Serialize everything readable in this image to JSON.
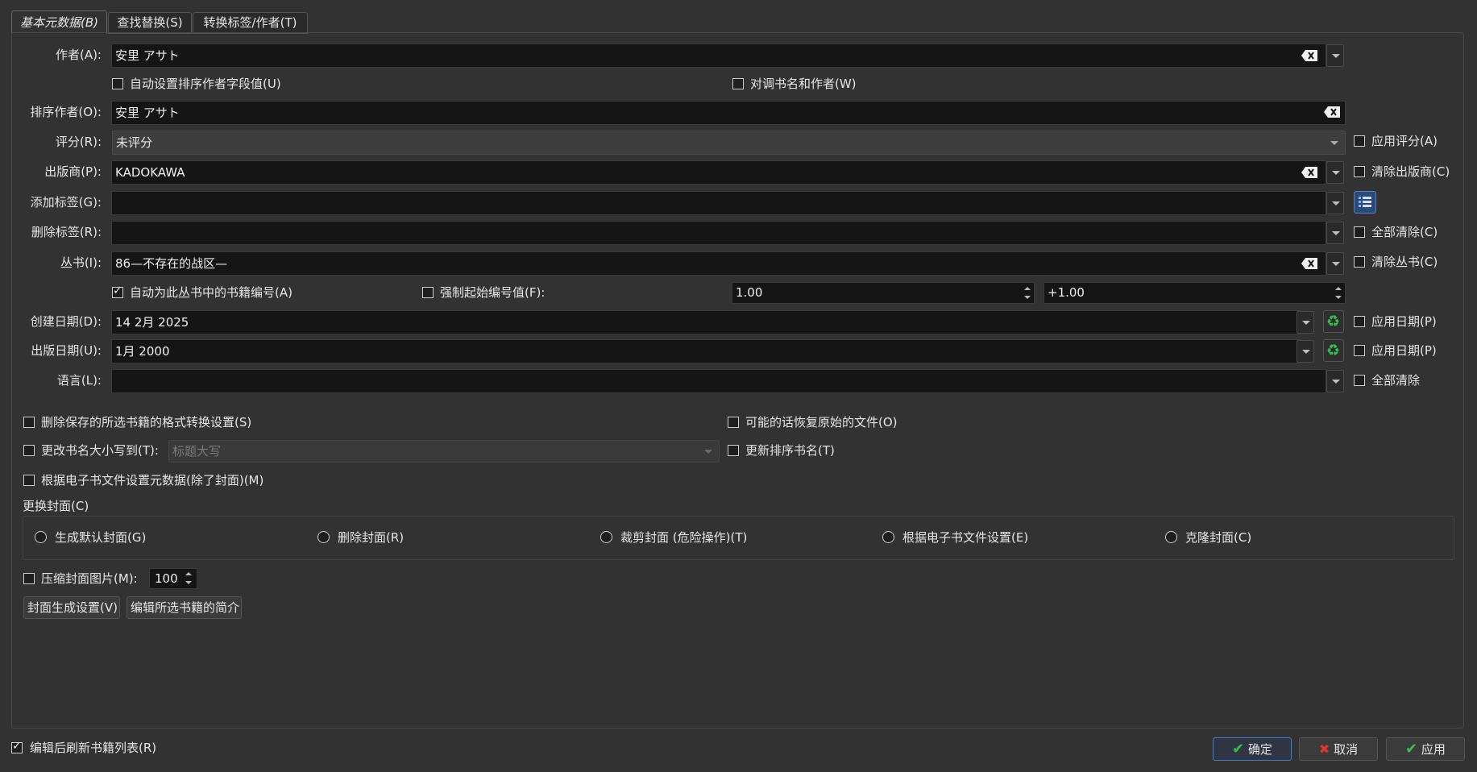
{
  "tabs": [
    {
      "label": "基本元数据(B)"
    },
    {
      "label": "查找替换(S)"
    },
    {
      "label": "转换标签/作者(T)"
    }
  ],
  "form": {
    "authors": {
      "label": "作者(A):",
      "value": "安里 アサト"
    },
    "auto_sort_label": "自动设置排序作者字段值(U)",
    "swap_label": "对调书名和作者(W)",
    "author_sort": {
      "label": "排序作者(O):",
      "value": "安里 アサト"
    },
    "rating": {
      "label": "评分(R):",
      "value": "未评分",
      "apply_label": "应用评分(A)"
    },
    "publisher": {
      "label": "出版商(P):",
      "value": "KADOKAWA",
      "clear_label": "清除出版商(C)"
    },
    "add_tags": {
      "label": "添加标签(G):",
      "value": ""
    },
    "remove_tags": {
      "label": "删除标签(R):",
      "value": "",
      "clear_label": "全部清除(C)"
    },
    "series": {
      "label": "丛书(I):",
      "value": "86—不存在的战区—",
      "clear_label": "清除丛书(C)"
    },
    "auto_number_label": "自动为此丛书中的书籍编号(A)",
    "force_start_label": "强制起始编号值(F):",
    "start_value": "1.00",
    "increment_value": "+1.00",
    "created": {
      "label": "创建日期(D):",
      "value": "14 2月 2025",
      "apply_label": "应用日期(P)"
    },
    "published": {
      "label": "出版日期(U):",
      "value": "1月 2000",
      "apply_label": "应用日期(P)"
    },
    "language": {
      "label": "语言(L):",
      "value": "",
      "clear_label": "全部清除"
    }
  },
  "options": {
    "remove_conversion": "删除保存的所选书籍的格式转换设置(S)",
    "restore_original": "可能的话恢复原始的文件(O)",
    "change_case": "更改书名大小写到(T):",
    "case_placeholder": "标题大写",
    "update_sort_title": "更新排序书名(T)",
    "set_from_file": "根据电子书文件设置元数据(除了封面)(M)"
  },
  "cover": {
    "group_label": "更换封面(C)",
    "radios": [
      {
        "label": "生成默认封面(G)"
      },
      {
        "label": "删除封面(R)"
      },
      {
        "label": "裁剪封面 (危险操作)(T)"
      },
      {
        "label": "根据电子书文件设置(E)"
      },
      {
        "label": "克隆封面(C)"
      }
    ],
    "compress_label": "压缩封面图片(M):",
    "compress_value": "100",
    "gen_settings_button": "封面生成设置(V)",
    "edit_desc_button": "编辑所选书籍的简介"
  },
  "footer": {
    "refresh_label": "编辑后刷新书籍列表(R)",
    "ok": "确定",
    "cancel": "取消",
    "apply": "应用"
  },
  "colors": {
    "accent": "#3d7bd6",
    "green": "#34c14a",
    "red": "#e03232"
  }
}
